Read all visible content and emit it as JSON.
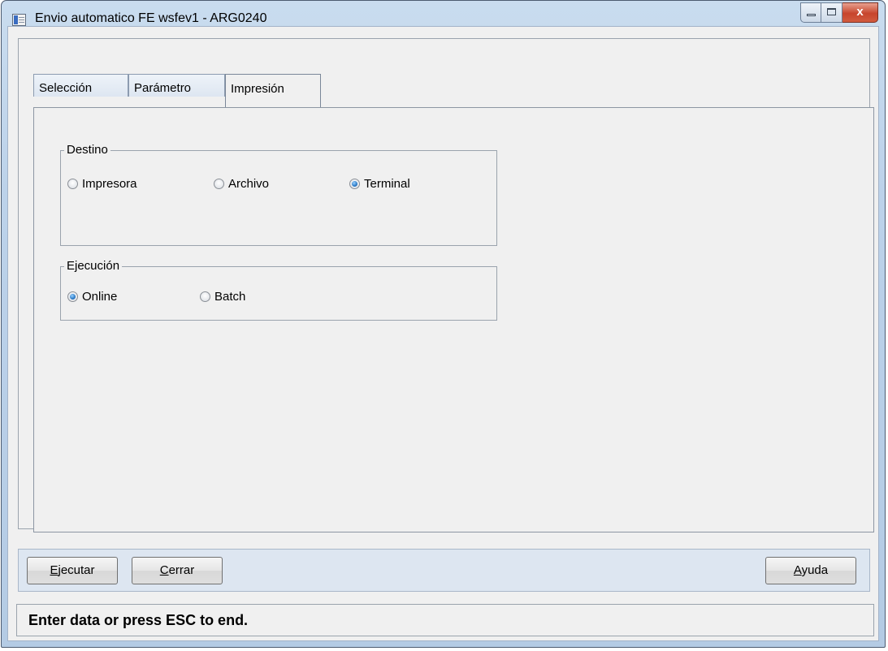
{
  "window": {
    "title": "Envio automatico FE wsfev1 - ARG0240",
    "min_glyph": "",
    "close_glyph": "x"
  },
  "tabs": [
    {
      "label": "Selección",
      "active": false
    },
    {
      "label": "Parámetro",
      "active": false
    },
    {
      "label": "Impresión",
      "active": true
    }
  ],
  "destino": {
    "label": "Destino",
    "options": [
      {
        "label": "Impresora",
        "checked": false
      },
      {
        "label": "Archivo",
        "checked": false
      },
      {
        "label": "Terminal",
        "checked": true
      }
    ]
  },
  "ejecucion": {
    "label": "Ejecución",
    "options": [
      {
        "label": "Online",
        "checked": true
      },
      {
        "label": "Batch",
        "checked": false
      }
    ]
  },
  "buttons": {
    "ejecutar": {
      "accel": "E",
      "rest": "jecutar"
    },
    "cerrar": {
      "accel": "C",
      "rest": "errar"
    },
    "ayuda": {
      "accel": "A",
      "rest": "yuda"
    }
  },
  "status": {
    "text": "Enter data or press ESC to end."
  }
}
